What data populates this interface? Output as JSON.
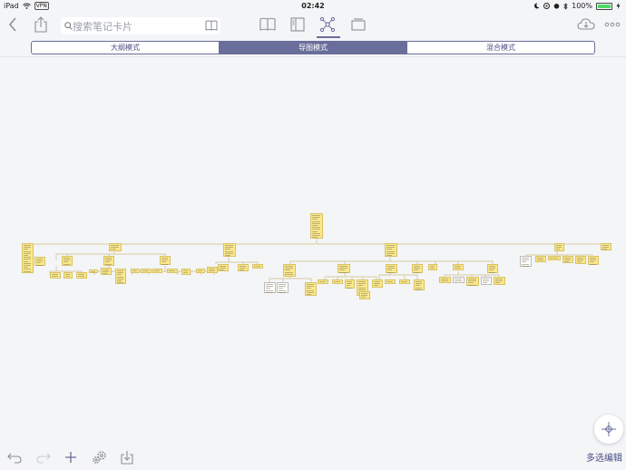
{
  "status": {
    "device": "iPad",
    "vpn": "VPN",
    "time": "02:42",
    "battery": "100%",
    "battery_level": 1.0
  },
  "search": {
    "placeholder": "搜索笔记卡片"
  },
  "modes": [
    {
      "label": "大纲模式",
      "active": false
    },
    {
      "label": "导图模式",
      "active": true
    },
    {
      "label": "混合模式",
      "active": false
    }
  ],
  "bottom": {
    "multi_edit": "多选编辑"
  },
  "colors": {
    "accent": "#6a6e9a",
    "note_yellow": "#fbe889",
    "line": "#c7b87a",
    "icon_gray": "#8a8f96"
  },
  "icons": {
    "toolbar": [
      "back-icon",
      "share-icon",
      "search-icon",
      "book-open-icon",
      "book-icon",
      "split-view-icon",
      "mindmap-icon",
      "cards-icon",
      "cloud-sync-icon",
      "more-icon"
    ],
    "bottom": [
      "undo-icon",
      "redo-icon",
      "add-icon",
      "settings-icon",
      "import-icon",
      "locate-icon"
    ]
  }
}
